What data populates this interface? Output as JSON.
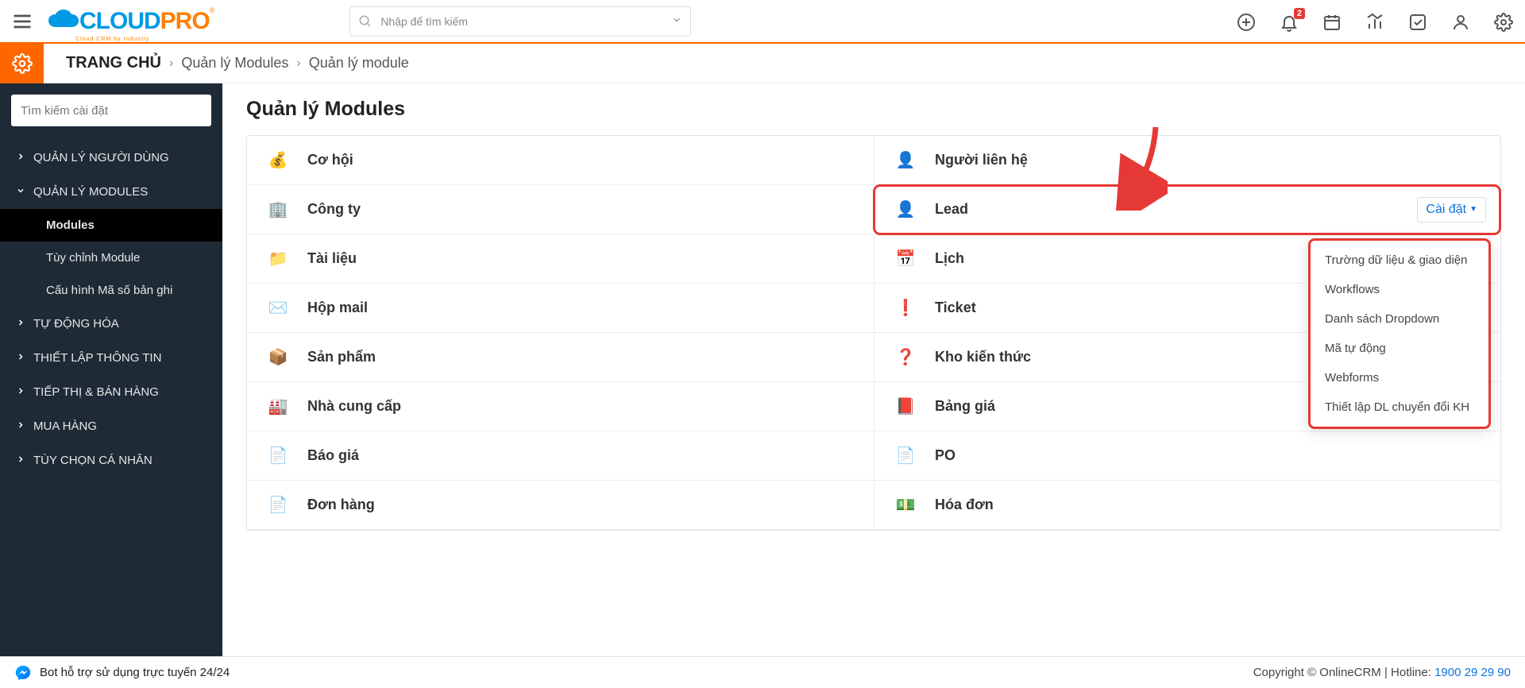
{
  "topbar": {
    "search_placeholder": "Nhập để tìm kiếm",
    "notification_badge": "2"
  },
  "breadcrumb": {
    "home": "TRANG CHỦ",
    "level1": "Quản lý Modules",
    "level2": "Quản lý module"
  },
  "sidebar": {
    "search_placeholder": "Tìm kiếm cài đặt",
    "items": [
      {
        "label": "QUẢN LÝ NGƯỜI DÙNG",
        "expanded": false
      },
      {
        "label": "QUẢN LÝ MODULES",
        "expanded": true,
        "children": [
          {
            "label": "Modules",
            "active": true
          },
          {
            "label": "Tùy chỉnh Module"
          },
          {
            "label": "Cấu hình Mã số bản ghi"
          }
        ]
      },
      {
        "label": "TỰ ĐỘNG HÓA"
      },
      {
        "label": "THIẾT LẬP THÔNG TIN"
      },
      {
        "label": "TIẾP THỊ & BÁN HÀNG"
      },
      {
        "label": "MUA HÀNG"
      },
      {
        "label": "TÙY CHỌN CÁ NHÂN"
      }
    ]
  },
  "page": {
    "title": "Quản lý Modules",
    "settings_label": "Cài đặt",
    "left_modules": [
      {
        "icon": "💰",
        "label": "Cơ hội"
      },
      {
        "icon": "🏢",
        "label": "Công ty"
      },
      {
        "icon": "📁",
        "label": "Tài liệu"
      },
      {
        "icon": "✉️",
        "label": "Hộp mail"
      },
      {
        "icon": "📦",
        "label": "Sản phẩm"
      },
      {
        "icon": "🏭",
        "label": "Nhà cung cấp"
      },
      {
        "icon": "📄",
        "label": "Báo giá"
      },
      {
        "icon": "📄",
        "label": "Đơn hàng"
      }
    ],
    "right_modules": [
      {
        "icon": "👤",
        "label": "Người liên hệ"
      },
      {
        "icon": "👤",
        "label": "Lead",
        "highlight": true,
        "has_settings": true
      },
      {
        "icon": "📅",
        "label": "Lịch"
      },
      {
        "icon": "❗",
        "label": "Ticket"
      },
      {
        "icon": "❓",
        "label": "Kho kiến thức"
      },
      {
        "icon": "📕",
        "label": "Bảng giá"
      },
      {
        "icon": "📄",
        "label": "PO"
      },
      {
        "icon": "💵",
        "label": "Hóa đơn"
      }
    ],
    "dropdown_items": [
      "Trường dữ liệu & giao diện",
      "Workflows",
      "Danh sách Dropdown",
      "Mã tự động",
      "Webforms",
      "Thiết lập DL chuyển đổi KH"
    ]
  },
  "footer": {
    "bot_text": "Bot hỗ trợ sử dụng trực tuyến 24/24",
    "copyright": "Copyright © OnlineCRM",
    "hotline_label": "Hotline:",
    "hotline_number": "1900 29 29 90"
  }
}
